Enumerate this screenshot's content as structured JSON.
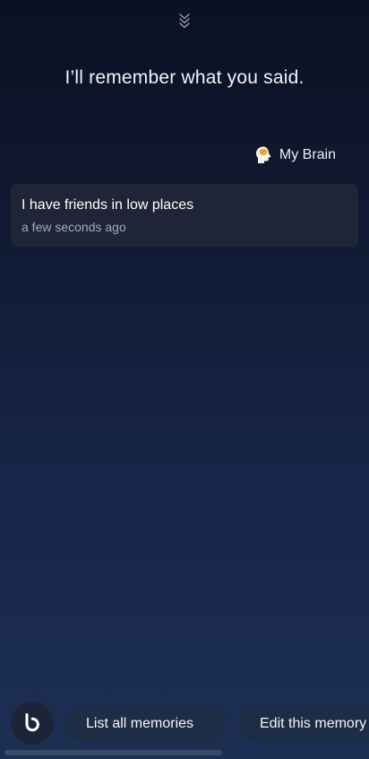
{
  "header": {
    "collapse_icon": "double-chevron-down-icon",
    "response_text": "I’ll remember what you said."
  },
  "source": {
    "icon": "brain-icon",
    "label": "My Brain"
  },
  "memory": {
    "text": "I have friends in low places",
    "timestamp": "a few seconds ago"
  },
  "bottom_bar": {
    "assistant_icon": "bixby-icon",
    "suggestions": [
      {
        "label": "List all memories"
      },
      {
        "label": "Edit this memory"
      }
    ]
  },
  "colors": {
    "background_top": "#0b1022",
    "background_bottom": "#1c3054",
    "card": "#1f2436",
    "chip": "#1d2d45",
    "timestamp": "#a4abba"
  }
}
